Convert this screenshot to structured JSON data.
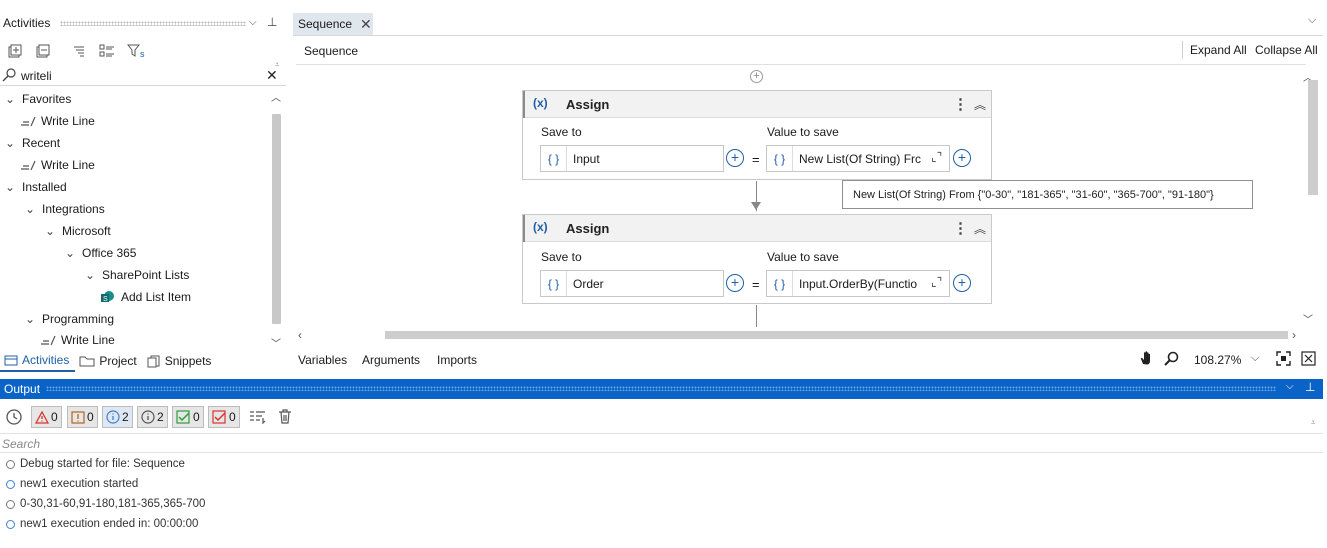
{
  "activities_panel": {
    "title": "Activities",
    "search_value": "writeli",
    "tree": [
      {
        "label": "Favorites",
        "level": 0,
        "kind": "group"
      },
      {
        "label": "Write Line",
        "level": 1,
        "kind": "activity",
        "icon": "write-line-icon"
      },
      {
        "label": "Recent",
        "level": 0,
        "kind": "group"
      },
      {
        "label": "Write Line",
        "level": 1,
        "kind": "activity",
        "icon": "write-line-icon"
      },
      {
        "label": "Installed",
        "level": 0,
        "kind": "group"
      },
      {
        "label": "Integrations",
        "level": 1,
        "kind": "group"
      },
      {
        "label": "Microsoft",
        "level": 2,
        "kind": "group"
      },
      {
        "label": "Office 365",
        "level": 3,
        "kind": "group"
      },
      {
        "label": "SharePoint Lists",
        "level": 4,
        "kind": "group"
      },
      {
        "label": "Add List Item",
        "level": 5,
        "kind": "activity",
        "icon": "sharepoint-icon"
      },
      {
        "label": "Programming",
        "level": 1,
        "kind": "group"
      },
      {
        "label": "Write Line",
        "level": 2,
        "kind": "activity",
        "icon": "write-line-icon"
      }
    ],
    "bottom_tabs": [
      "Activities",
      "Project",
      "Snippets"
    ]
  },
  "designer": {
    "tab_label": "Sequence",
    "breadcrumb": "Sequence",
    "expand_all": "Expand All",
    "collapse_all": "Collapse All",
    "activities": [
      {
        "title": "Assign",
        "save_to_label": "Save to",
        "value_label": "Value to save",
        "save_to_value": "Input",
        "value": "New List(Of String) Frc"
      },
      {
        "title": "Assign",
        "save_to_label": "Save to",
        "value_label": "Value to save",
        "save_to_value": "Order",
        "value": "Input.OrderBy(Functio"
      }
    ],
    "tooltip": "New List(Of String) From {\"0-30\", \"181-365\", \"31-60\", \"365-700\", \"91-180\"}",
    "bottom_tabs": [
      "Variables",
      "Arguments",
      "Imports"
    ],
    "zoom": "108.27%"
  },
  "output": {
    "title": "Output",
    "filters": [
      {
        "icon": "error-icon",
        "count": "0",
        "color": "#d9342b"
      },
      {
        "icon": "warning-icon",
        "count": "0",
        "color": "#b5651d"
      },
      {
        "icon": "info-icon",
        "count": "2",
        "color": "#3d7fd0"
      },
      {
        "icon": "trace-icon",
        "count": "2",
        "color": "#555555"
      },
      {
        "icon": "success-icon",
        "count": "0",
        "color": "#2e9d3a"
      },
      {
        "icon": "failure-icon",
        "count": "0",
        "color": "#d9342b"
      }
    ],
    "search_placeholder": "Search",
    "logs": [
      {
        "text": "Debug started for file: Sequence",
        "color": "gray"
      },
      {
        "text": "new1 execution started",
        "color": "blue"
      },
      {
        "text": "0-30,31-60,91-180,181-365,365-700",
        "color": "gray"
      },
      {
        "text": "new1 execution ended in: 00:00:00",
        "color": "blue"
      }
    ]
  }
}
